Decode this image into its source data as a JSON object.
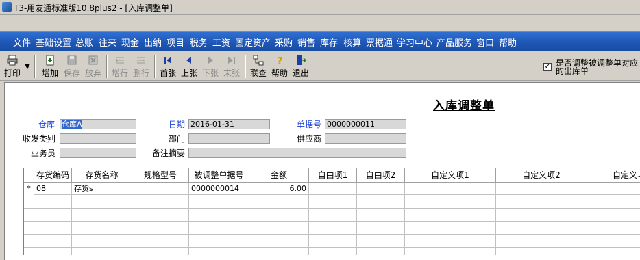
{
  "window": {
    "title": "T3-用友通标准版10.8plus2 - [入库调整单]"
  },
  "menu": [
    "文件",
    "基础设置",
    "总账",
    "往来",
    "现金",
    "出纳",
    "项目",
    "税务",
    "工资",
    "固定资产",
    "采购",
    "销售",
    "库存",
    "核算",
    "票据通",
    "学习中心",
    "产品服务",
    "窗口",
    "帮助"
  ],
  "toolbar": {
    "print": "打印",
    "add": "增加",
    "save": "保存",
    "abandon": "放弃",
    "add_row": "增行",
    "del_row": "删行",
    "first": "首张",
    "prev": "上张",
    "next": "下张",
    "last": "末张",
    "linked": "联查",
    "help": "帮助",
    "exit": "退出"
  },
  "option": {
    "label": "是否调整被调整单对应的出库单",
    "checked": true,
    "mark": "✓"
  },
  "form": {
    "title": "入库调整单",
    "warehouse_label": "仓库",
    "warehouse_value": "仓库A",
    "date_label": "日期",
    "date_value": "2016-01-31",
    "doc_no_label": "单据号",
    "doc_no_value": "0000000011",
    "recv_type_label": "收发类别",
    "dept_label": "部门",
    "supplier_label": "供应商",
    "clerk_label": "业务员",
    "remark_label": "备注摘要"
  },
  "grid": {
    "columns": [
      "存货编码",
      "存货名称",
      "规格型号",
      "被调整单据号",
      "金额",
      "自由项1",
      "自由项2",
      "自定义项1",
      "自定义项2",
      "自定义项"
    ],
    "rows": [
      {
        "marker": "*",
        "code": "08",
        "name": "存货s",
        "spec": "",
        "adj_doc": "0000000014",
        "amount": "6.00"
      }
    ]
  }
}
